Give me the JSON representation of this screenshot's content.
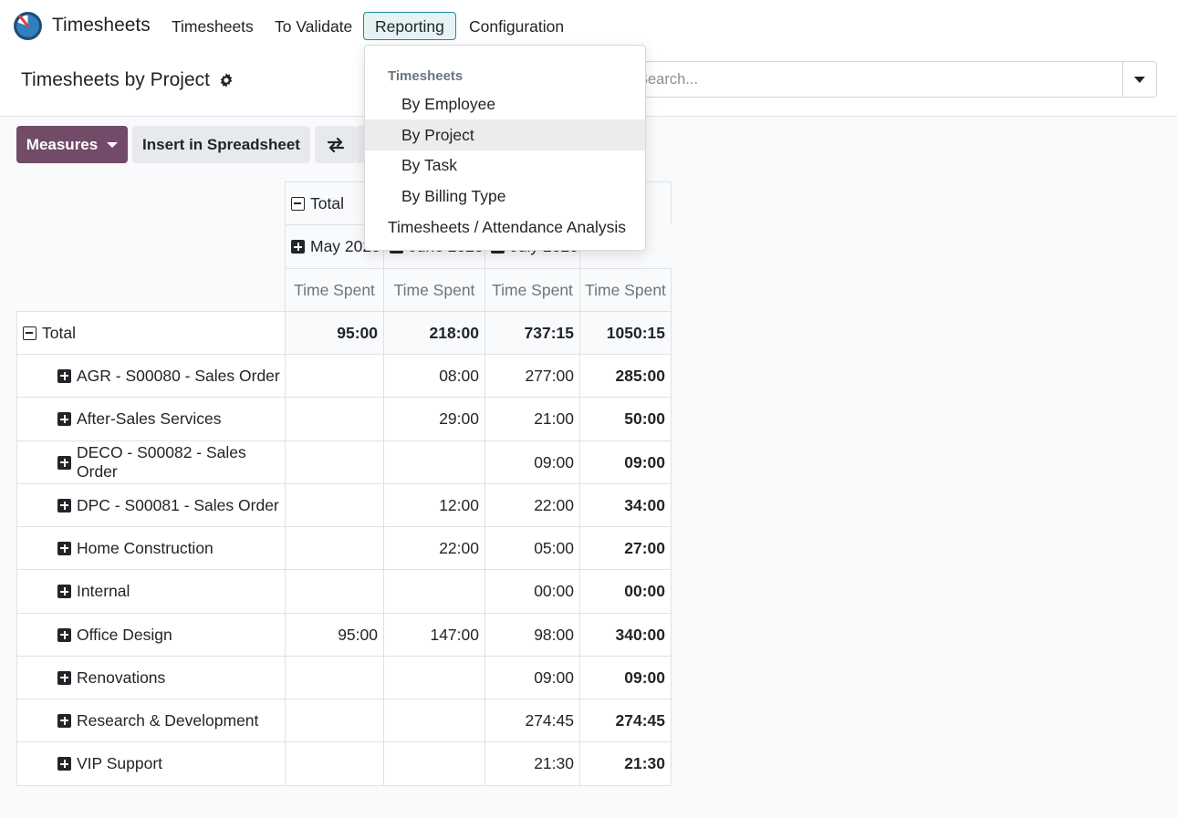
{
  "app": {
    "name": "Timesheets"
  },
  "nav": [
    {
      "label": "Timesheets"
    },
    {
      "label": "To Validate"
    },
    {
      "label": "Reporting"
    },
    {
      "label": "Configuration"
    }
  ],
  "breadcrumb": {
    "title": "Timesheets by Project"
  },
  "search": {
    "placeholder": "Search..."
  },
  "toolbar": {
    "measures_label": "Measures",
    "spreadsheet_label": "Insert in Spreadsheet"
  },
  "reporting_menu": {
    "section": "Timesheets",
    "items": [
      "By Employee",
      "By Project",
      "By Task",
      "By Billing Type"
    ],
    "extra": "Timesheets / Attendance Analysis",
    "selected": "By Project"
  },
  "pivot": {
    "col_total_label": "Total",
    "months": [
      "May 2023",
      "June 2023",
      "July 2023"
    ],
    "measure": "Time Spent",
    "row_total_label": "Total",
    "totals": [
      "95:00",
      "218:00",
      "737:15",
      "1050:15"
    ],
    "rows": [
      {
        "label": "AGR - S00080 - Sales Order",
        "values": [
          "",
          "08:00",
          "277:00",
          "285:00"
        ]
      },
      {
        "label": "After-Sales Services",
        "values": [
          "",
          "29:00",
          "21:00",
          "50:00"
        ]
      },
      {
        "label": "DECO - S00082 - Sales Order",
        "values": [
          "",
          "",
          "09:00",
          "09:00"
        ]
      },
      {
        "label": "DPC - S00081 - Sales Order",
        "values": [
          "",
          "12:00",
          "22:00",
          "34:00"
        ]
      },
      {
        "label": "Home Construction",
        "values": [
          "",
          "22:00",
          "05:00",
          "27:00"
        ]
      },
      {
        "label": "Internal",
        "values": [
          "",
          "",
          "00:00",
          "00:00"
        ]
      },
      {
        "label": "Office Design",
        "values": [
          "95:00",
          "147:00",
          "98:00",
          "340:00"
        ]
      },
      {
        "label": "Renovations",
        "values": [
          "",
          "",
          "09:00",
          "09:00"
        ]
      },
      {
        "label": "Research & Development",
        "values": [
          "",
          "",
          "274:45",
          "274:45"
        ]
      },
      {
        "label": "VIP Support",
        "values": [
          "",
          "",
          "21:30",
          "21:30"
        ]
      }
    ]
  },
  "colors": {
    "brand": "#714b67",
    "active_nav_border": "#1a8d9f"
  },
  "icons": [
    "app-logo-icon",
    "gear-icon",
    "search-caret-icon",
    "swap-arrows-icon",
    "plus-square-icon",
    "minus-square-icon"
  ]
}
